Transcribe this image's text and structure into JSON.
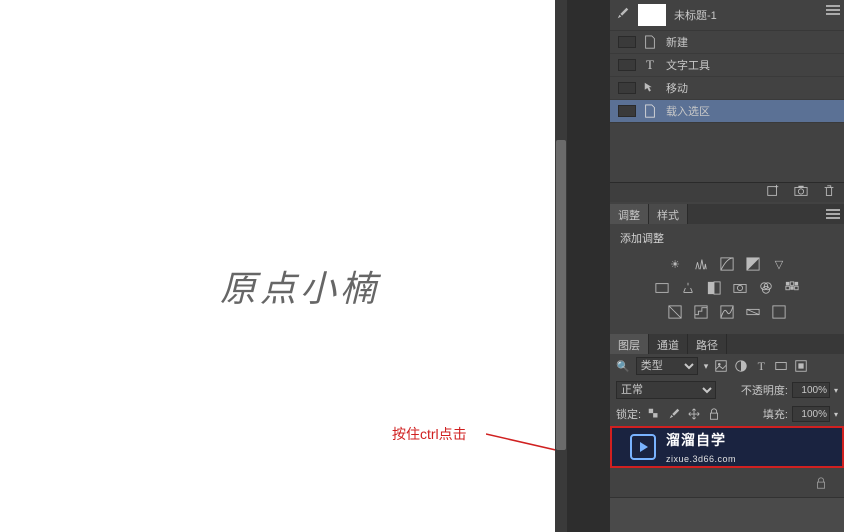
{
  "canvas": {
    "text": "原点小楠"
  },
  "annotation": {
    "text": "按住ctrl点击"
  },
  "history": {
    "doc_title": "未标题-1",
    "items": [
      {
        "label": "新建",
        "icon": "doc"
      },
      {
        "label": "文字工具",
        "icon": "type"
      },
      {
        "label": "移动",
        "icon": "move"
      },
      {
        "label": "载入选区",
        "icon": "doc",
        "selected": true
      }
    ]
  },
  "adjustments": {
    "tabs": {
      "adjust": "调整",
      "styles": "样式"
    },
    "prompt": "添加调整"
  },
  "layers": {
    "tabs": {
      "layers": "图层",
      "channels": "通道",
      "paths": "路径"
    },
    "filter_label": "类型",
    "blend_mode": "正常",
    "opacity_label": "不透明度:",
    "opacity_value": "100%",
    "lock_label": "锁定:",
    "fill_label": "填充:",
    "fill_value": "100%"
  },
  "watermark": {
    "brand": "溜溜自学",
    "url": "zixue.3d66.com"
  }
}
